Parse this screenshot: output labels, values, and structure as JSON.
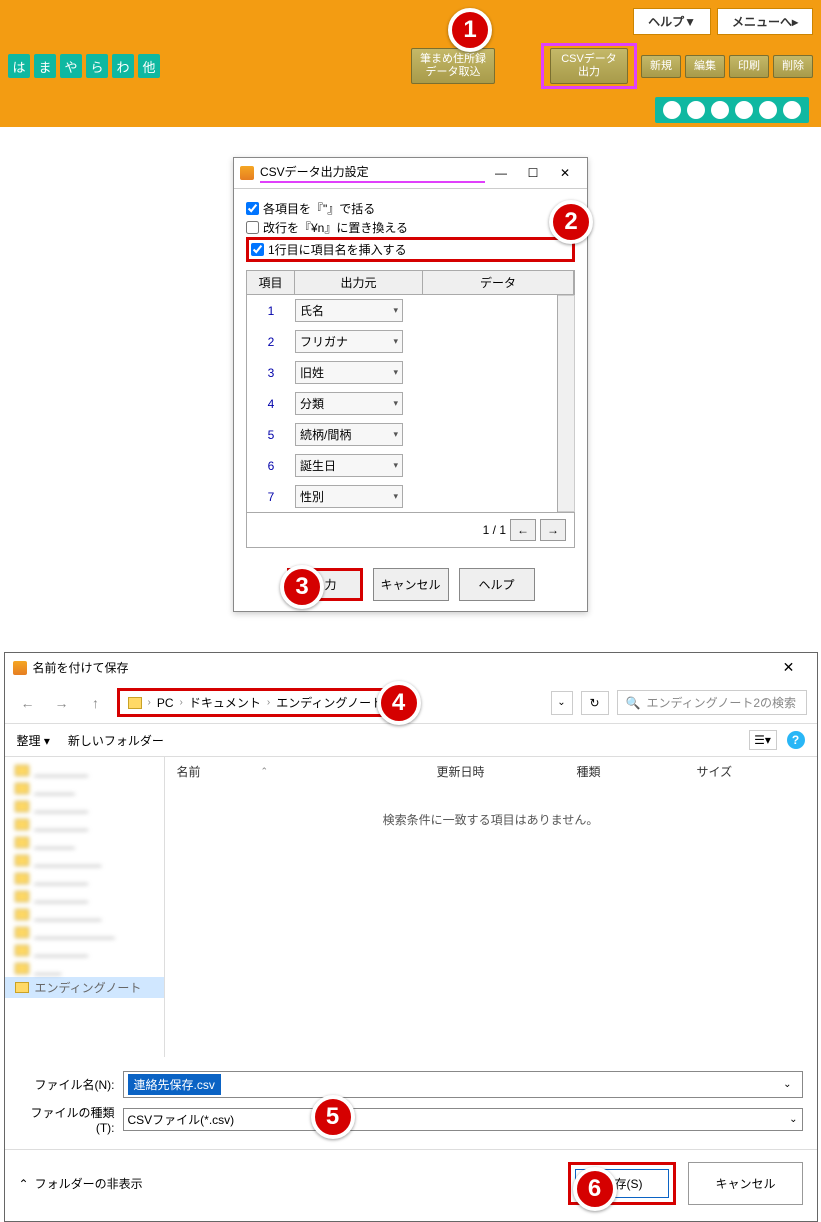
{
  "topbar": {
    "help": "ヘルプ▼",
    "menu": "メニューへ▸",
    "kana": [
      "は",
      "ま",
      "や",
      "ら",
      "わ",
      "他"
    ],
    "import_btn": "筆まめ住所録\nデータ取込",
    "csv_export": "CSVデータ\n出力",
    "new": "新規",
    "edit": "編集",
    "print": "印刷",
    "delete": "削除"
  },
  "csv_dialog": {
    "title": "CSVデータ出力設定",
    "chk_quote": "各項目を『\"』で括る",
    "chk_newline": "改行を『¥n』に置き換える",
    "chk_header": "1行目に項目名を挿入する",
    "col_idx": "項目",
    "col_src": "出力元",
    "col_data": "データ",
    "rows": [
      {
        "n": "1",
        "v": "氏名"
      },
      {
        "n": "2",
        "v": "フリガナ"
      },
      {
        "n": "3",
        "v": "旧姓"
      },
      {
        "n": "4",
        "v": "分類"
      },
      {
        "n": "5",
        "v": "続柄/間柄"
      },
      {
        "n": "6",
        "v": "誕生日"
      },
      {
        "n": "7",
        "v": "性別"
      }
    ],
    "page": "1 / 1",
    "btn_output": "出力",
    "btn_cancel": "キャンセル",
    "btn_help": "ヘルプ"
  },
  "save_dialog": {
    "title": "名前を付けて保存",
    "crumb_pc": "PC",
    "crumb_doc": "ドキュメント",
    "crumb_folder": "エンディングノート2",
    "search_placeholder": "エンディングノート2の検索",
    "organize": "整理 ▾",
    "new_folder": "新しいフォルダー",
    "col_name": "名前",
    "col_date": "更新日時",
    "col_type": "種類",
    "col_size": "サイズ",
    "empty_msg": "検索条件に一致する項目はありません。",
    "tree_selected": "エンディングノート",
    "file_label": "ファイル名(N):",
    "file_value": "連絡先保存.csv",
    "type_label": "ファイルの種類(T):",
    "type_value": "CSVファイル(*.csv)",
    "hide_folders": "フォルダーの非表示",
    "btn_save": "保存(S)",
    "btn_cancel": "キャンセル"
  },
  "badges": {
    "b1": "1",
    "b2": "2",
    "b3": "3",
    "b4": "4",
    "b5": "5",
    "b6": "6"
  }
}
